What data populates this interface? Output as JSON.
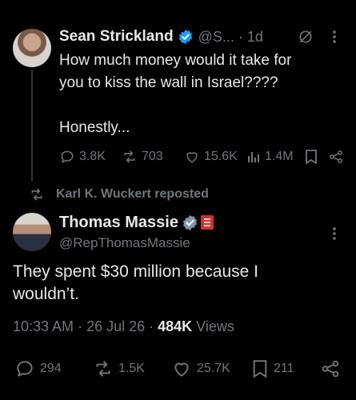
{
  "tweet1": {
    "author_name": "Sean Strickland",
    "handle": "@S...",
    "separator": "·",
    "time": "1d",
    "text_line1": "How much money would it take for",
    "text_line2": "you to kiss the wall in Israel????",
    "text_line3": "Honestly...",
    "replies": "3.8K",
    "reposts": "703",
    "likes": "15.6K",
    "views": "1.4M"
  },
  "repost_banner": {
    "text": "Karl K. Wuckert reposted"
  },
  "tweet2": {
    "author_name": "Thomas Massie",
    "handle": "@RepThomasMassie",
    "text_line1": "They spent $30 million because I",
    "text_line2": "wouldn’t.",
    "time": "10:33 AM",
    "dot1": "·",
    "date": "26 Jul 26",
    "dot2": "·",
    "views_count": "484K",
    "views_label": "Views",
    "replies": "294",
    "reposts": "1.5K",
    "likes": "25.7K",
    "bookmarks": "211"
  },
  "colors": {
    "background": "#000000",
    "text_primary": "#e7e9ea",
    "text_muted": "#71767b",
    "verified_blue": "#1d9bf0",
    "verified_gray": "#829aab",
    "flag_red": "#d0312d"
  },
  "icons": [
    "reply-icon",
    "repost-icon",
    "like-icon",
    "views-icon",
    "bookmark-icon",
    "share-icon",
    "verified-badge-icon",
    "more-icon",
    "grok-icon"
  ]
}
